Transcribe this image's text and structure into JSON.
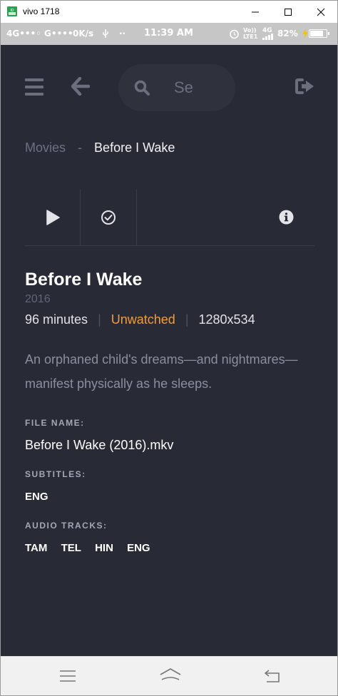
{
  "window": {
    "title": "vivo 1718",
    "minimize_glyph": "—",
    "maximize_glyph": "☐",
    "close_glyph": "✕"
  },
  "statusbar": {
    "signal_left": "4G•••◦ G••••",
    "speed": "0K/s",
    "usb_icon": "usb-icon",
    "dots": "··",
    "time": "11:39 AM",
    "alarm_icon": "alarm-icon",
    "volte": "Vo)) LTE1",
    "network": "4G",
    "battery": "82%",
    "battery_level": 0.82,
    "colors": {
      "bg": "#c6c6c6",
      "text": "#ffffff"
    }
  },
  "app": {
    "colors": {
      "background": "#282a36",
      "accent": "#f39c3d",
      "muted": "#6d7082"
    },
    "search": {
      "placeholder": "Se"
    },
    "icons": {
      "menu": "hamburger-menu-icon",
      "back": "arrow-left-icon",
      "search": "search-icon",
      "logout": "sign-out-icon"
    },
    "breadcrumb": {
      "parent": "Movies",
      "separator": "-",
      "current": "Before I Wake"
    },
    "actions": {
      "play": "play-icon",
      "watched": "check-circle-icon",
      "info": "info-icon"
    },
    "movie": {
      "title": "Before I Wake",
      "year": "2016",
      "runtime": "96 minutes",
      "watch_status": "Unwatched",
      "resolution": "1280x534",
      "meta_separator": "|",
      "description": "An orphaned child's dreams—and nightmares—manifest physically as he sleeps.",
      "file_name_label": "FILE NAME:",
      "file_name": "Before I Wake (2016).mkv",
      "subtitles_label": "SUBTITLES:",
      "subtitles": [
        "ENG"
      ],
      "audio_label": "AUDIO TRACKS:",
      "audio_tracks": [
        "TAM",
        "TEL",
        "HIN",
        "ENG"
      ]
    }
  },
  "navbar": {
    "menu": "menu-icon",
    "home": "home-icon",
    "back": "back-icon"
  }
}
